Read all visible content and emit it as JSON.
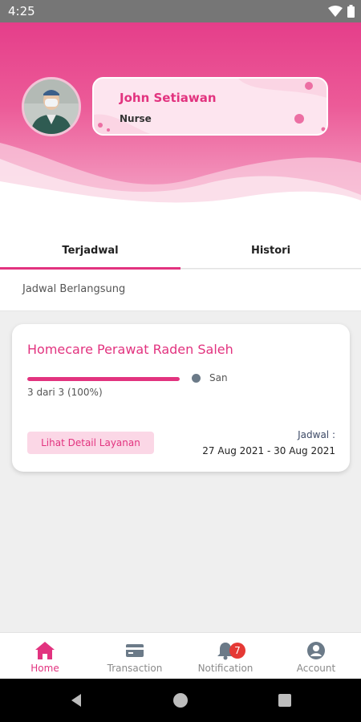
{
  "status_bar": {
    "time": "4:25"
  },
  "profile": {
    "name": "John Setiawan",
    "role": "Nurse"
  },
  "tabs": [
    {
      "label": "Terjadwal",
      "active": true
    },
    {
      "label": "Histori",
      "active": false
    }
  ],
  "section": {
    "label": "Jadwal Berlangsung"
  },
  "service_card": {
    "title": "Homecare Perawat Raden Saleh",
    "progress_fraction": 1.0,
    "progress_text": "3 dari 3 (100%)",
    "legend_label": "San",
    "detail_button": "Lihat Detail Layanan",
    "schedule_label": "Jadwal :",
    "schedule_value": "27 Aug 2021 - 30 Aug 2021"
  },
  "bottom_nav": [
    {
      "label": "Home",
      "icon": "home-icon",
      "active": true
    },
    {
      "label": "Transaction",
      "icon": "card-icon",
      "active": false
    },
    {
      "label": "Notification",
      "icon": "bell-icon",
      "active": false,
      "badge": "7"
    },
    {
      "label": "Account",
      "icon": "account-icon",
      "active": false
    }
  ],
  "colors": {
    "accent": "#e2337f",
    "header_top": "#e53e8a",
    "legend_dot": "#6b7a88",
    "badge": "#e53935"
  }
}
